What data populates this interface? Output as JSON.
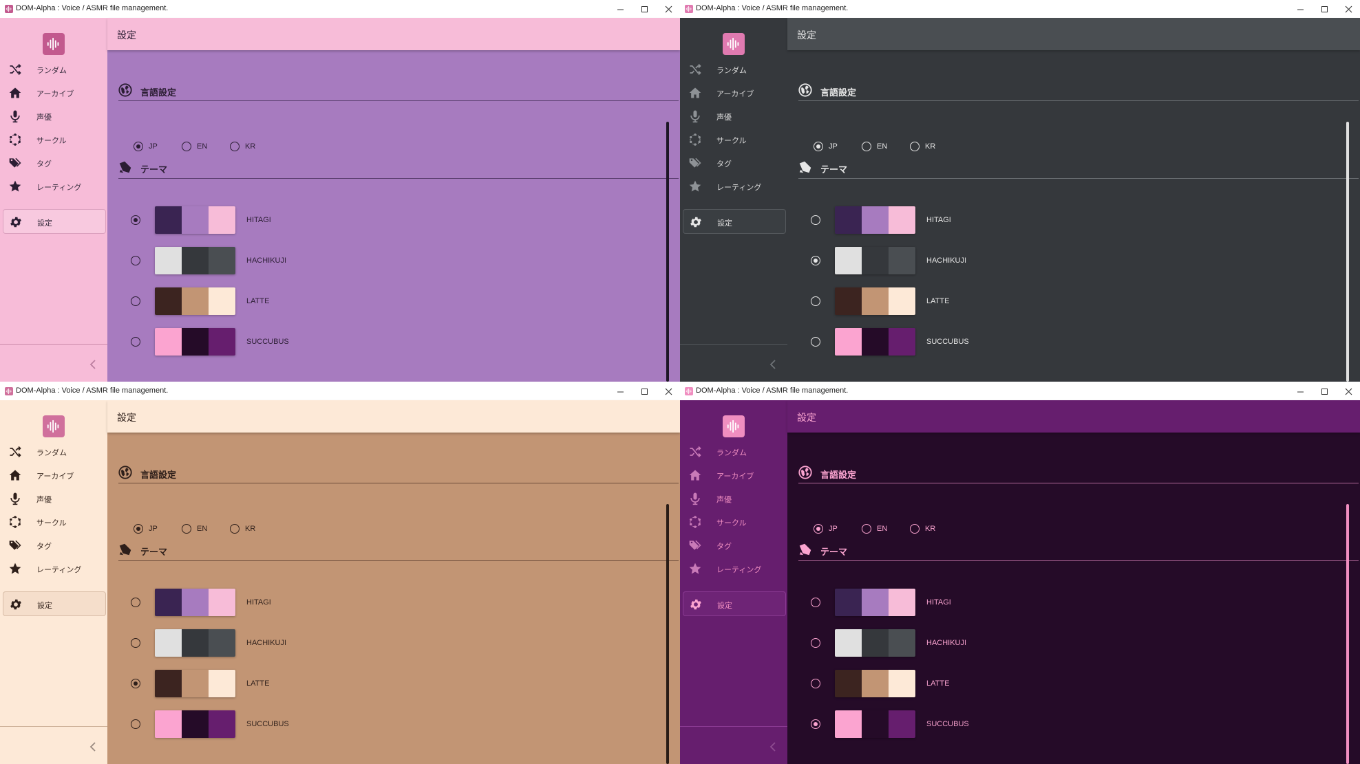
{
  "app": {
    "window_title": "DOM-Alpha : Voice / ASMR file management."
  },
  "nav": {
    "items": [
      {
        "label": "ランダム",
        "icon": "shuffle-icon"
      },
      {
        "label": "アーカイブ",
        "icon": "home-icon"
      },
      {
        "label": "声優",
        "icon": "microphone-icon"
      },
      {
        "label": "サークル",
        "icon": "circle-dots-icon"
      },
      {
        "label": "タグ",
        "icon": "tags-icon"
      },
      {
        "label": "レーティング",
        "icon": "star-icon"
      },
      {
        "label": "設定",
        "icon": "gear-icon"
      }
    ]
  },
  "page": {
    "title": "設定"
  },
  "language": {
    "title": "言語設定",
    "options": [
      "JP",
      "EN",
      "KR"
    ],
    "selected": "JP"
  },
  "theme": {
    "title": "テーマ",
    "options": [
      {
        "name": "HITAGI",
        "colors": [
          "#3a2452",
          "#a77bbf",
          "#f7bcd8"
        ]
      },
      {
        "name": "HACHIKUJI",
        "colors": [
          "#e0e0e0",
          "#35383c",
          "#4a4e52"
        ]
      },
      {
        "name": "LATTE",
        "colors": [
          "#3c2420",
          "#c29574",
          "#fde9d7"
        ]
      },
      {
        "name": "SUCCUBUS",
        "colors": [
          "#fba4d0",
          "#250b28",
          "#661e6e"
        ]
      }
    ]
  },
  "windows": [
    {
      "selected_theme": "HITAGI",
      "colors": {
        "sidebar": "#f7bcd8",
        "header": "#f7bcd8",
        "content": "#a77bbf",
        "text": "#2b1d33",
        "nav_text": "#3a2f40",
        "nav_icon": "#2b1d33",
        "muted_icon": "#bb7ea0",
        "accent": "#c2598e",
        "active_bg": "#f8c9df",
        "active_border": "#dba0be",
        "divider": "#c98aa9",
        "sec_line": "#5a3e6e",
        "radio": "#2b1d33",
        "scroll": "#1e1626"
      }
    },
    {
      "selected_theme": "HACHIKUJI",
      "colors": {
        "sidebar": "#35383c",
        "header": "#4a4e52",
        "content": "#35383c",
        "text": "#e6e6e6",
        "nav_text": "#d8d8d8",
        "nav_icon": "#8e9296",
        "muted_icon": "#6e7276",
        "accent": "#e07ab0",
        "active_bg": "#3a3e42",
        "active_border": "#55595d",
        "divider": "#55595d",
        "sec_line": "#6a6e72",
        "radio": "#e6e6e6",
        "scroll": "#e0e0e0"
      }
    },
    {
      "selected_theme": "LATTE",
      "colors": {
        "sidebar": "#fde9d7",
        "header": "#fde9d7",
        "content": "#c29574",
        "text": "#2e1f1a",
        "nav_text": "#3a2a22",
        "nav_icon": "#2e1f1a",
        "muted_icon": "#9a8a80",
        "accent": "#d0709c",
        "active_bg": "#f5decb",
        "active_border": "#d8bca6",
        "divider": "#cfb29a",
        "sec_line": "#6b4a38",
        "radio": "#2e1f1a",
        "scroll": "#2a1c16"
      }
    },
    {
      "selected_theme": "SUCCUBUS",
      "colors": {
        "sidebar": "#661e6e",
        "header": "#661e6e",
        "content": "#250b28",
        "text": "#fba4d0",
        "nav_text": "#f08ec0",
        "nav_icon": "#c97ab8",
        "muted_icon": "#8e4c90",
        "accent": "#f08ec0",
        "active_bg": "#6e2476",
        "active_border": "#8a3a92",
        "divider": "#8a3a92",
        "sec_line": "#b46a9c",
        "radio": "#fba4d0",
        "scroll": "#f08ec0"
      }
    }
  ]
}
